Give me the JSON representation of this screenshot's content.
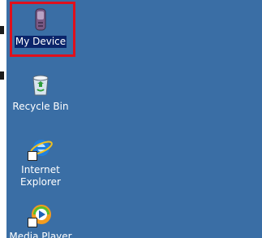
{
  "desktop": {
    "icons": [
      {
        "label": "My Device",
        "icon": "my-device-icon",
        "selected": true
      },
      {
        "label": "Recycle Bin",
        "icon": "recycle-bin-icon",
        "selected": false
      },
      {
        "label": "Internet\nExplorer",
        "icon": "internet-explorer-icon",
        "selected": false
      },
      {
        "label": "Media Player",
        "icon": "media-player-icon",
        "selected": false
      }
    ]
  },
  "colors": {
    "desktop_background": "#3a6ea5",
    "selection_background": "#0a246a",
    "highlight_border": "#e0101c"
  }
}
